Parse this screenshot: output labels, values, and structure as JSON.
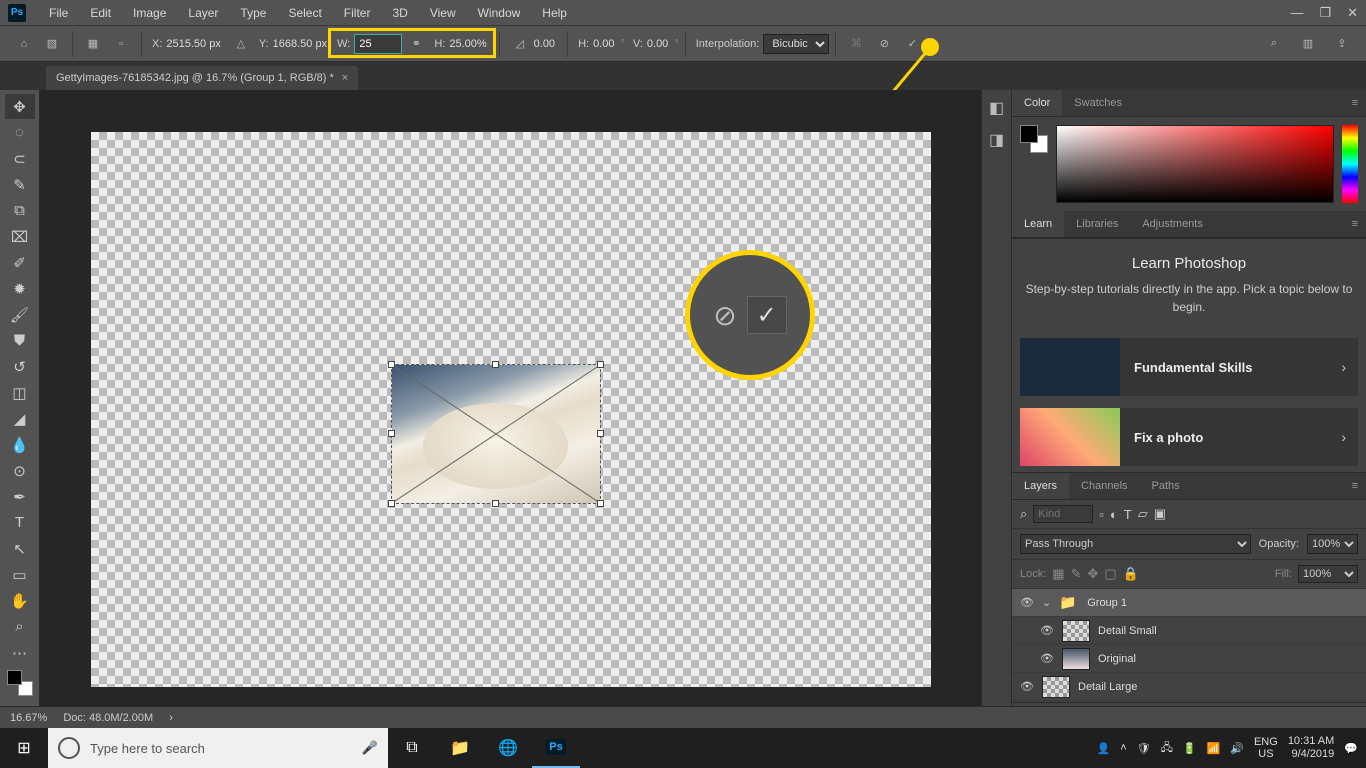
{
  "menu": {
    "items": [
      "File",
      "Edit",
      "Image",
      "Layer",
      "Type",
      "Select",
      "Filter",
      "3D",
      "View",
      "Window",
      "Help"
    ]
  },
  "options": {
    "x_label": "X:",
    "x": "2515.50 px",
    "y_label": "Y:",
    "y": "1668.50 px",
    "w_label": "W:",
    "w": "25",
    "h_label": "H:",
    "h": "25.00%",
    "rot_label": "",
    "rot": "0.00",
    "sh_h_label": "H:",
    "sh_h": "0.00",
    "sh_v_label": "V:",
    "sh_v": "0.00",
    "interp_label": "Interpolation:",
    "interp": "Bicubic"
  },
  "doc_tab": "GettyImages-76185342.jpg @ 16.7% (Group 1, RGB/8) *",
  "panels": {
    "color_tab": "Color",
    "swatches_tab": "Swatches",
    "learn_tab": "Learn",
    "libraries_tab": "Libraries",
    "adjustments_tab": "Adjustments",
    "learn_title": "Learn Photoshop",
    "learn_sub": "Step-by-step tutorials directly in the app. Pick a topic below to begin.",
    "card1": "Fundamental Skills",
    "card2": "Fix a photo",
    "layers_tab": "Layers",
    "channels_tab": "Channels",
    "paths_tab": "Paths",
    "kind_ph": "Kind",
    "blend": "Pass Through",
    "opacity_label": "Opacity:",
    "opacity": "100%",
    "lock_label": "Lock:",
    "fill_label": "Fill:",
    "fill": "100%",
    "layer_group": "Group 1",
    "layer1": "Detail Small",
    "layer2": "Original",
    "layer3": "Detail Large"
  },
  "status": {
    "zoom": "16.67%",
    "doc": "Doc: 48.0M/2.00M"
  },
  "taskbar": {
    "search_ph": "Type here to search",
    "lang1": "ENG",
    "lang2": "US",
    "time": "10:31 AM",
    "date": "9/4/2019"
  }
}
